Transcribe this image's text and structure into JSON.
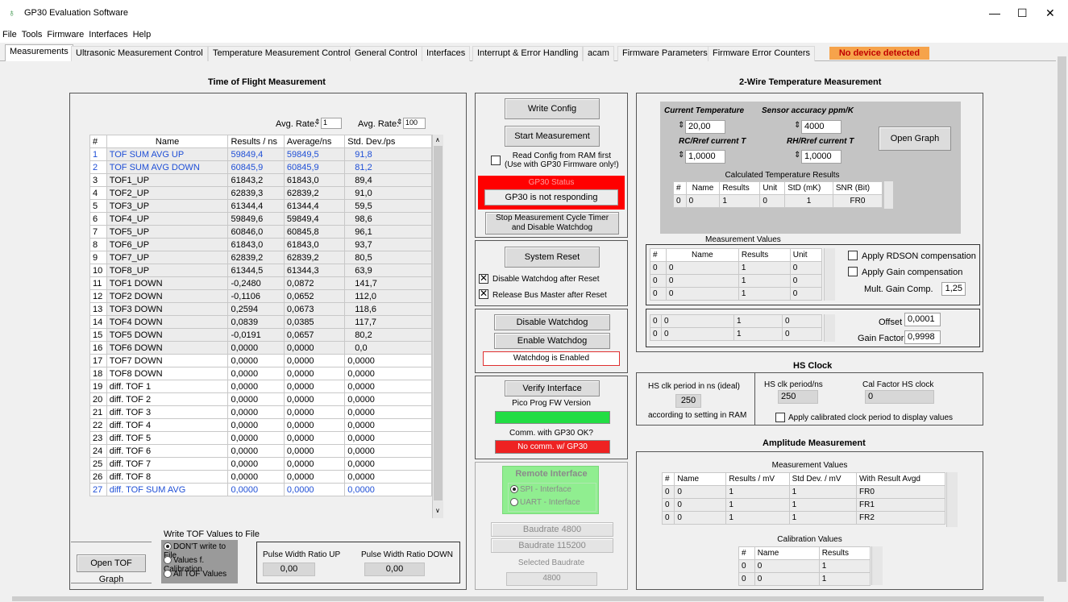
{
  "window": {
    "title": "GP30 Evaluation Software",
    "minimize": "—",
    "maximize": "☐",
    "close": "✕"
  },
  "menu": [
    "File",
    "Tools",
    "Firmware",
    "Interfaces",
    "Help"
  ],
  "tabs": [
    "Measurements",
    "Ultrasonic Measurement Control",
    "Temperature Measurement Control",
    "General Control",
    "Interfaces",
    "Interrupt & Error Handling",
    "acam",
    "Firmware Parameters",
    "Firmware Error Counters"
  ],
  "status_badge": "No device detected",
  "tof": {
    "title": "Time of Flight Measurement",
    "avg_rate1_label": "Avg. Rate:",
    "avg_rate1": "1",
    "avg_rate2_label": "Avg. Rate:",
    "avg_rate2": "100",
    "headers": [
      "#",
      "Name",
      "Results / ns",
      "Average/ns",
      "Std. Dev./ps"
    ],
    "rows": [
      [
        "1",
        "TOF SUM AVG UP",
        "59849,4",
        "59849,5",
        "91,8"
      ],
      [
        "2",
        "TOF SUM AVG DOWN",
        "60845,9",
        "60845,9",
        "81,2"
      ],
      [
        "3",
        "TOF1_UP",
        "61843,2",
        "61843,0",
        "89,4"
      ],
      [
        "4",
        "TOF2_UP",
        "62839,3",
        "62839,2",
        "91,0"
      ],
      [
        "5",
        "TOF3_UP",
        "61344,4",
        "61344,4",
        "59,5"
      ],
      [
        "6",
        "TOF4_UP",
        "59849,6",
        "59849,4",
        "98,6"
      ],
      [
        "7",
        "TOF5_UP",
        "60846,0",
        "60845,8",
        "96,1"
      ],
      [
        "8",
        "TOF6_UP",
        "61843,0",
        "61843,0",
        "93,7"
      ],
      [
        "9",
        "TOF7_UP",
        "62839,2",
        "62839,2",
        "80,5"
      ],
      [
        "10",
        "TOF8_UP",
        "61344,5",
        "61344,3",
        "63,9"
      ],
      [
        "11",
        "TOF1 DOWN",
        "-0,2480",
        "0,0872",
        "141,7"
      ],
      [
        "12",
        "TOF2 DOWN",
        "-0,1106",
        "0,0652",
        "112,0"
      ],
      [
        "13",
        "TOF3 DOWN",
        "0,2594",
        "0,0673",
        "118,6"
      ],
      [
        "14",
        "TOF4 DOWN",
        "0,0839",
        "0,0385",
        "117,7"
      ],
      [
        "15",
        "TOF5 DOWN",
        "-0,0191",
        "0,0657",
        "80,2"
      ],
      [
        "16",
        "TOF6 DOWN",
        "0,0000",
        "0,0000",
        "0,0"
      ],
      [
        "17",
        "TOF7 DOWN",
        "0,0000",
        "0,0000",
        "0,0000"
      ],
      [
        "18",
        "TOF8 DOWN",
        "0,0000",
        "0,0000",
        "0,0000"
      ],
      [
        "19",
        "diff. TOF 1",
        "0,0000",
        "0,0000",
        "0,0000"
      ],
      [
        "20",
        "diff. TOF 2",
        "0,0000",
        "0,0000",
        "0,0000"
      ],
      [
        "21",
        "diff. TOF 3",
        "0,0000",
        "0,0000",
        "0,0000"
      ],
      [
        "22",
        "diff. TOF 4",
        "0,0000",
        "0,0000",
        "0,0000"
      ],
      [
        "23",
        "diff. TOF 5",
        "0,0000",
        "0,0000",
        "0,0000"
      ],
      [
        "24",
        "diff. TOF 6",
        "0,0000",
        "0,0000",
        "0,0000"
      ],
      [
        "25",
        "diff. TOF 7",
        "0,0000",
        "0,0000",
        "0,0000"
      ],
      [
        "26",
        "diff. TOF 8",
        "0,0000",
        "0,0000",
        "0,0000"
      ],
      [
        "27",
        "diff. TOF SUM AVG",
        "0,0000",
        "0,0000",
        "0,0000"
      ]
    ],
    "blue_rows": [
      0,
      1,
      26
    ],
    "open_graph": "Open TOF Graph",
    "write_label": "Write TOF Values to File",
    "radios": [
      "DON'T write to File",
      "Values f. Calibration",
      "All TOF Values"
    ],
    "pw_up_label": "Pulse Width Ratio UP",
    "pw_up": "0,00",
    "pw_down_label": "Pulse Width Ratio DOWN",
    "pw_down": "0,00"
  },
  "ctrl": {
    "write_config": "Write Config",
    "start_meas": "Start Measurement",
    "read_config": "Read Config from RAM first\n(Use with GP30 Firmware only!)",
    "status_title": "GP30 Status",
    "status_text": "GP30 is not responding",
    "stop_timer": "Stop Measurement Cycle Timer\nand Disable Watchdog",
    "system_reset": "System Reset",
    "disable_wd_reset": "Disable Watchdog after Reset",
    "release_bus": "Release Bus Master after Reset",
    "disable_wd": "Disable Watchdog",
    "enable_wd": "Enable Watchdog",
    "wd_status": "Watchdog is Enabled",
    "verify": "Verify Interface",
    "pico_label": "Pico Prog FW Version",
    "comm_label": "Comm. with GP30 OK?",
    "comm_status": "No comm. w/ GP30",
    "remote_title": "Remote Interface",
    "spi": "SPI - Interface",
    "uart": "UART - Interface",
    "baud4800": "Baudrate 4800",
    "baud115200": "Baudrate 115200",
    "selected_baud_label": "Selected Baudrate",
    "selected_baud": "4800"
  },
  "temp": {
    "title": "2-Wire Temperature Measurement",
    "cur_temp_label": "Current Temperature",
    "cur_temp": "20,00",
    "sensor_acc_label": "Sensor accuracy ppm/K",
    "sensor_acc": "4000",
    "rc_label": "RC/Rref current T",
    "rc": "1,0000",
    "rh_label": "RH/Rref current T",
    "rh": "1,0000",
    "open_graph": "Open Graph",
    "calc_label": "Calculated Temperature Results",
    "calc_headers": [
      "#",
      "Name",
      "Results",
      "Unit",
      "StD (mK)",
      "SNR (Bit)"
    ],
    "calc_row": [
      "0",
      "0",
      "1",
      "0",
      "1",
      "FR0"
    ],
    "mv_label": "Measurement Values",
    "mv_headers": [
      "#",
      "Name",
      "Results",
      "Unit"
    ],
    "mv_rows": [
      [
        "0",
        "0",
        "1",
        "0"
      ],
      [
        "0",
        "0",
        "1",
        "0"
      ],
      [
        "0",
        "0",
        "1",
        "0"
      ]
    ],
    "rdson": "Apply RDSON compensation",
    "gain_comp": "Apply Gain compensation",
    "mult_label": "Mult. Gain Comp.",
    "mult": "1,25",
    "off_rows": [
      [
        "0",
        "0",
        "1",
        "0"
      ],
      [
        "0",
        "0",
        "1",
        "0"
      ]
    ],
    "offset_label": "Offset",
    "offset": "0,0001",
    "gain_label": "Gain Factor",
    "gain": "0,9998"
  },
  "hs": {
    "title": "HS Clock",
    "ideal_label": "HS clk period in ns (ideal)",
    "ideal": "250",
    "ideal_note": "according to setting in RAM",
    "period_label": "HS clk period/ns",
    "period": "250",
    "cal_label": "Cal Factor HS clock",
    "cal": "0",
    "apply": "Apply calibrated clock period to display values"
  },
  "amp": {
    "title": "Amplitude Measurement",
    "mv_label": "Measurement Values",
    "headers": [
      "#",
      "Name",
      "Results / mV",
      "Std Dev. / mV",
      "With Result Avgd"
    ],
    "rows": [
      [
        "0",
        "0",
        "1",
        "1",
        "FR0"
      ],
      [
        "0",
        "0",
        "1",
        "1",
        "FR1"
      ],
      [
        "0",
        "0",
        "1",
        "1",
        "FR2"
      ]
    ],
    "cal_label": "Calibration Values",
    "cal_headers": [
      "#",
      "Name",
      "Results"
    ],
    "cal_rows": [
      [
        "0",
        "0",
        "1"
      ],
      [
        "0",
        "0",
        "1"
      ]
    ]
  },
  "colors": {
    "orange": "#f6a34b",
    "red": "#ff0000",
    "green": "#22dd44",
    "blue": "#1f4fd6"
  }
}
